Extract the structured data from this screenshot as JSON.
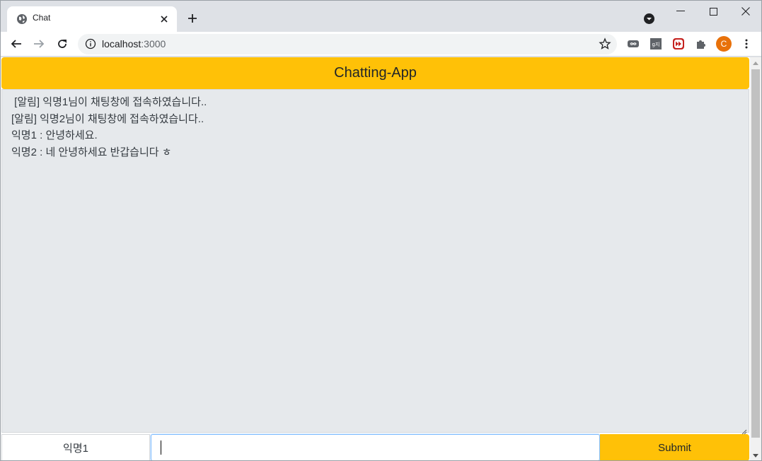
{
  "browser": {
    "tab_title": "Chat",
    "url_host": "localhost",
    "url_port": ":3000",
    "profile_initial": "C",
    "extensions": [
      "infinity-extension-icon",
      "translate-extension-icon",
      "red-extension-icon",
      "puzzle-icon"
    ]
  },
  "app": {
    "header_title": "Chatting-App",
    "messages": [
      " [알림] 익명1님이 채팅창에 접속하였습니다..",
      "[알림] 익명2님이 채팅창에 접속하였습니다..",
      "익명1 : 안녕하세요.",
      "익명2 : 네 안녕하세요 반갑습니다 ㅎ"
    ],
    "username": "익명1",
    "message_input_value": "",
    "submit_label": "Submit"
  },
  "colors": {
    "accent": "#ffc107",
    "chat_bg": "#e6e9ec",
    "focus_border": "#80bdff",
    "avatar": "#e8710a"
  }
}
